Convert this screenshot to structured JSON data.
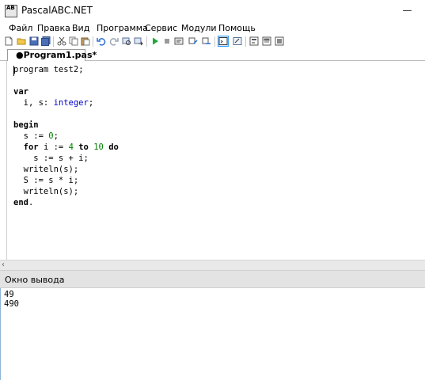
{
  "window": {
    "title": "PascalABC.NET",
    "icon_text": "AB",
    "minimize_glyph": "—"
  },
  "menu": [
    "Файл",
    "Правка",
    "Вид",
    "Программа",
    "Сервис",
    "Модули",
    "Помощь"
  ],
  "toolbar": {
    "icons": [
      "new-file-icon",
      "open-file-icon",
      "save-icon",
      "save-all-icon",
      "cut-icon",
      "copy-icon",
      "paste-icon",
      "undo-icon",
      "redo-icon",
      "find-icon",
      "replace-icon",
      "run-icon",
      "stop-icon",
      "debug-icon",
      "step-over-icon",
      "step-into-icon",
      "output-window-icon",
      "watch-window-icon",
      "form-designer-icon",
      "compile-icon",
      "build-icon"
    ]
  },
  "tab": {
    "label": "●Program1.pas*"
  },
  "editor": {
    "lines": [
      [
        {
          "t": "program",
          "c": "plain"
        },
        {
          "t": " test2;",
          "c": "plain"
        }
      ],
      [],
      [
        {
          "t": "var",
          "c": "kw"
        }
      ],
      [
        {
          "t": "  i, s: ",
          "c": "plain"
        },
        {
          "t": "integer",
          "c": "type"
        },
        {
          "t": ";",
          "c": "plain"
        }
      ],
      [],
      [
        {
          "t": "begin",
          "c": "kw"
        }
      ],
      [
        {
          "t": "  s := ",
          "c": "plain"
        },
        {
          "t": "0",
          "c": "num"
        },
        {
          "t": ";",
          "c": "plain"
        }
      ],
      [
        {
          "t": "  ",
          "c": "plain"
        },
        {
          "t": "for",
          "c": "kw"
        },
        {
          "t": " i := ",
          "c": "plain"
        },
        {
          "t": "4",
          "c": "num"
        },
        {
          "t": " ",
          "c": "plain"
        },
        {
          "t": "to",
          "c": "kw"
        },
        {
          "t": " ",
          "c": "plain"
        },
        {
          "t": "10",
          "c": "num"
        },
        {
          "t": " ",
          "c": "plain"
        },
        {
          "t": "do",
          "c": "kw"
        }
      ],
      [
        {
          "t": "    s := s + i;",
          "c": "plain"
        }
      ],
      [
        {
          "t": "  writeln(s);",
          "c": "plain"
        }
      ],
      [
        {
          "t": "  S := s * i;",
          "c": "plain"
        }
      ],
      [
        {
          "t": "  writeln(s);",
          "c": "plain"
        }
      ],
      [
        {
          "t": "end",
          "c": "kw"
        },
        {
          "t": ".",
          "c": "plain"
        }
      ]
    ]
  },
  "scroll": {
    "left_arrow": "‹"
  },
  "output_panel": {
    "title": "Окно вывода",
    "lines": [
      "49",
      "490"
    ]
  },
  "colors": {
    "keyword": "#000000",
    "type": "#0000cc",
    "number": "#008000",
    "output_header": "#e3e3e3"
  }
}
